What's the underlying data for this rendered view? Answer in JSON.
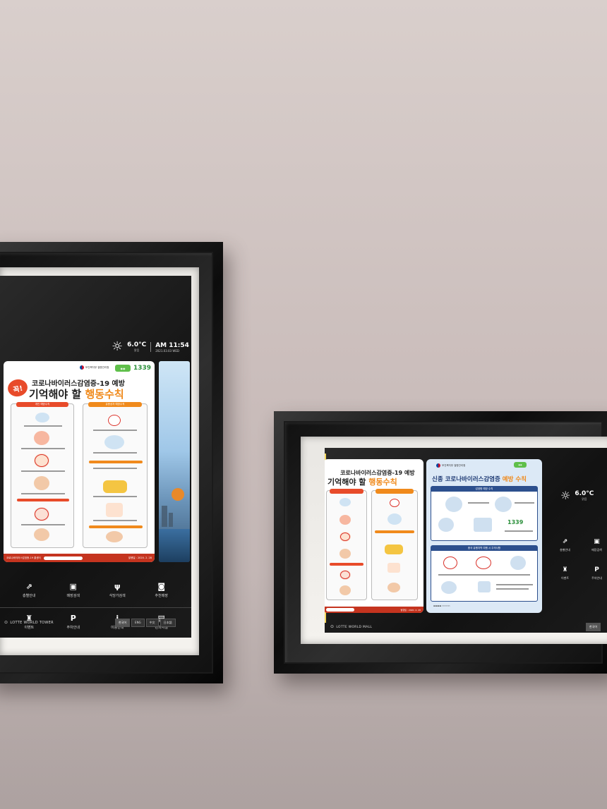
{
  "frame1": {
    "weather": {
      "temp": "6.0°C",
      "cond": "맑음"
    },
    "clock": {
      "time": "AM 11:54",
      "date": "2021.03.03 WED"
    },
    "poster": {
      "ministry": "보건복지부 질병관리청",
      "badge": "1339",
      "kkok": "꼭!",
      "title1": "코로나바이러스감염증-19 예방",
      "title2a": "기억해야 할 ",
      "title2b": "행동수칙",
      "col_left": "개인 예방수칙",
      "col_right": "유증상자 예방수칙",
      "footer": "코로나바이러스감염증-19 콜센터",
      "date": "발행일 : 2020. 2. 28"
    },
    "menu": [
      {
        "icon": "escalator-icon",
        "glyph": "⇗",
        "label": "층별안내"
      },
      {
        "icon": "shopping-bag-icon",
        "glyph": "▣",
        "label": "매장검색"
      },
      {
        "icon": "fork-knife-icon",
        "glyph": "ψ",
        "label": "식당가검색"
      },
      {
        "icon": "recommend-icon",
        "glyph": "◙",
        "label": "추천매장"
      },
      {
        "icon": "event-icon",
        "glyph": "♜",
        "label": "이벤트"
      },
      {
        "icon": "parking-icon",
        "glyph": "P",
        "label": "주차안내"
      },
      {
        "icon": "info-icon",
        "glyph": "i",
        "label": "이용안내"
      },
      {
        "icon": "sofa-icon",
        "glyph": "▤",
        "label": "편의시설"
      }
    ],
    "brand": "LOTTE WORLD TOWER",
    "langs": [
      "한국어",
      "ENG",
      "中文",
      "日本語"
    ]
  },
  "frame2": {
    "weather": {
      "temp": "6.0°C",
      "cond": "맑음"
    },
    "poster_left": {
      "title1": "코로나바이러스감염증-19 예방",
      "title2a": "기억해야 할 ",
      "title2b": "행동수칙",
      "date": "발행일 : 2020. 2. 28"
    },
    "poster_right": {
      "ministry": "보건복지부 질병관리청",
      "title_a": "신종 코로나바이러스감염증 ",
      "title_b": "예방 수칙",
      "sec1": "감염병 예방 수칙",
      "sec2": "중국 유행지역 여행 시 주의사항",
      "badge": "1339"
    },
    "menu": [
      {
        "icon": "escalator-icon",
        "glyph": "⇗",
        "label": "층별안내"
      },
      {
        "icon": "shopping-bag-icon",
        "glyph": "▣",
        "label": "매장검색"
      },
      {
        "icon": "event-icon",
        "glyph": "♜",
        "label": "이벤트"
      },
      {
        "icon": "parking-icon",
        "glyph": "P",
        "label": "주차안내"
      }
    ],
    "brand": "LOTTE WORLD MALL",
    "langs": [
      "한국어"
    ]
  }
}
